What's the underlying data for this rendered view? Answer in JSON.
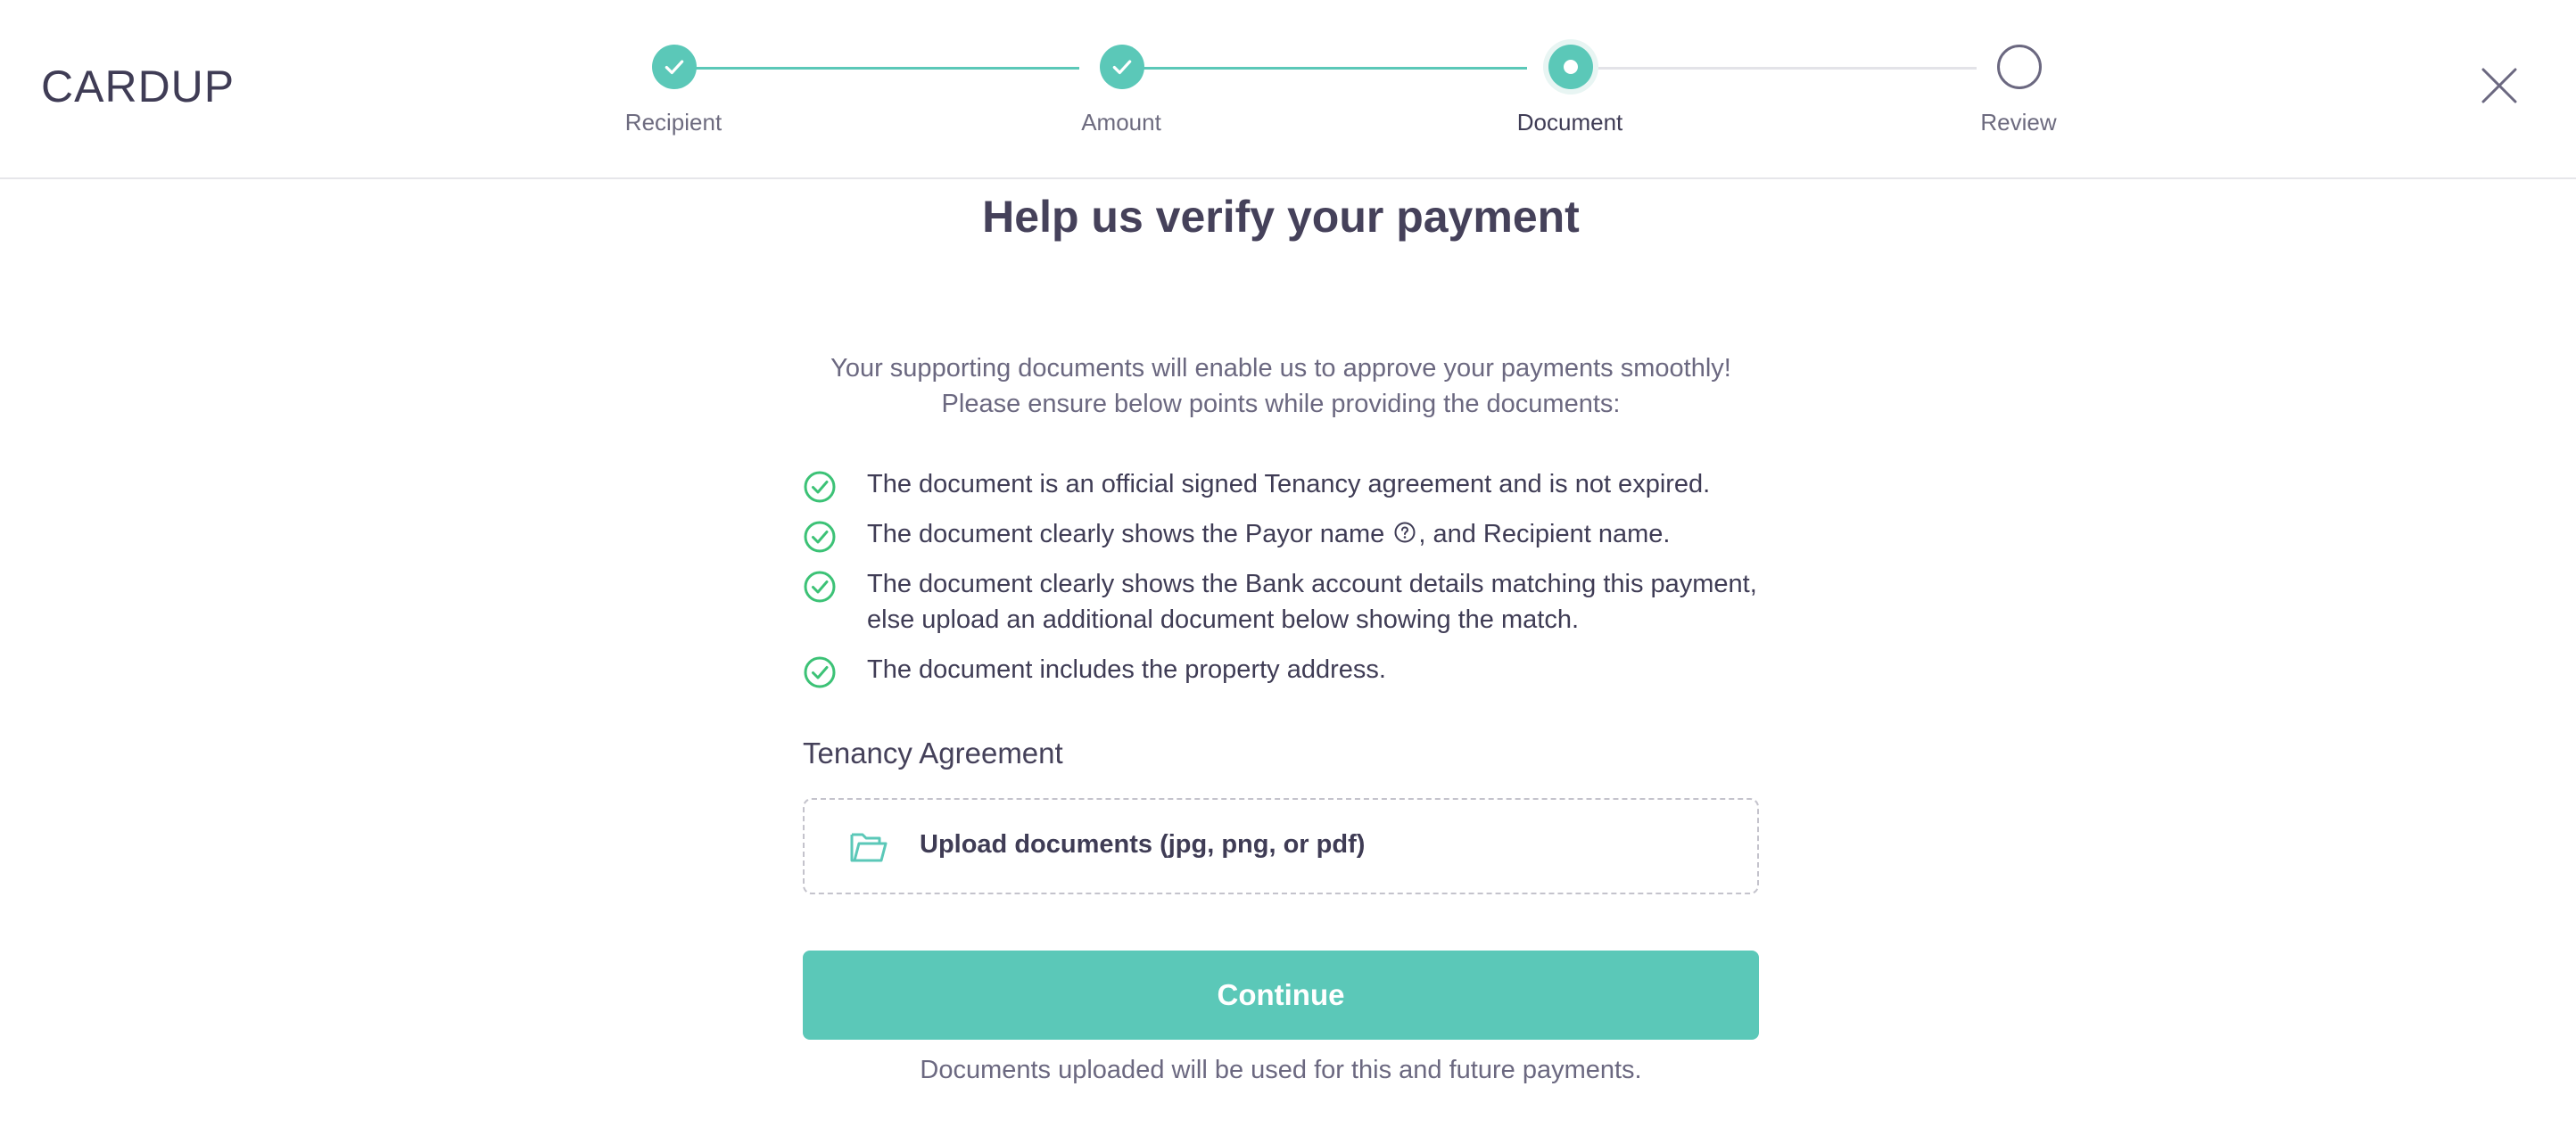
{
  "brand": {
    "logo_text": "CARDUP"
  },
  "colors": {
    "accent": "#5bc8b8",
    "success_check": "#3cc276",
    "text_dark": "#3f3c55",
    "text_muted": "#6b6880",
    "inactive_line": "#e3e3e8"
  },
  "stepper": {
    "steps": [
      {
        "label": "Recipient",
        "state": "done",
        "icon": "check-icon"
      },
      {
        "label": "Amount",
        "state": "done",
        "icon": "check-icon"
      },
      {
        "label": "Document",
        "state": "current",
        "icon": "dot-icon"
      },
      {
        "label": "Review",
        "state": "todo",
        "icon": "empty-circle-icon"
      }
    ]
  },
  "header": {
    "close_icon": "close-icon"
  },
  "main": {
    "title": "Help us verify your payment",
    "intro_line1": "Your supporting documents will enable us to approve your payments smoothly!",
    "intro_line2": "Please ensure below points while providing the documents:",
    "checklist": [
      {
        "text": "The document is an official signed Tenancy agreement and is not expired."
      },
      {
        "text_before": "The document clearly shows the Payor name",
        "text_after": ", and Recipient name.",
        "help_icon": "help-circle-icon"
      },
      {
        "text": "The document clearly shows the Bank account details matching this payment, else upload an additional document below showing the match."
      },
      {
        "text": "The document includes the property address."
      }
    ],
    "section_label": "Tenancy Agreement",
    "upload_label": "Upload documents (jpg, png, or pdf)",
    "upload_icon": "folder-open-icon",
    "continue_label": "Continue",
    "footnote": "Documents uploaded will be used for this and future payments."
  }
}
